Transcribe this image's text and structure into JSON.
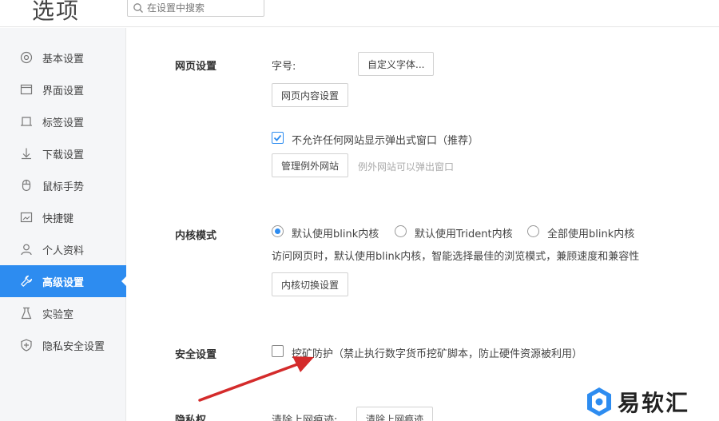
{
  "header": {
    "title": "选项",
    "search_placeholder": "在设置中搜索"
  },
  "sidebar": {
    "items": [
      {
        "label": "基本设置",
        "icon": "settings-circle-icon"
      },
      {
        "label": "界面设置",
        "icon": "window-icon"
      },
      {
        "label": "标签设置",
        "icon": "tab-icon"
      },
      {
        "label": "下载设置",
        "icon": "download-icon"
      },
      {
        "label": "鼠标手势",
        "icon": "mouse-icon"
      },
      {
        "label": "快捷键",
        "icon": "keyboard-icon"
      },
      {
        "label": "个人资料",
        "icon": "user-icon"
      },
      {
        "label": "高级设置",
        "icon": "wrench-icon",
        "active": true
      },
      {
        "label": "实验室",
        "icon": "flask-icon"
      },
      {
        "label": "隐私安全设置",
        "icon": "shield-icon"
      }
    ],
    "accent_color": "#2d8cf0"
  },
  "webpage": {
    "section": "网页设置",
    "font_label": "字号:",
    "custom_font_button": "自定义字体...",
    "content_settings_button": "网页内容设置",
    "popup_checkbox_label": "不允许任何网站显示弹出式窗口（推荐）",
    "popup_checked": true,
    "manage_exceptions_button": "管理例外网站",
    "exceptions_hint": "例外网站可以弹出窗口"
  },
  "kernel": {
    "section": "内核模式",
    "options": [
      "默认使用blink内核",
      "默认使用Trident内核",
      "全部使用blink内核"
    ],
    "selected": "默认使用blink内核",
    "description": "访问网页时，默认使用blink内核，智能选择最佳的浏览模式，兼顾速度和兼容性",
    "switch_button": "内核切换设置"
  },
  "security": {
    "section": "安全设置",
    "mining_label": "挖矿防护（禁止执行数字货币挖矿脚本，防止硬件资源被利用）",
    "mining_checked": false
  },
  "privacy": {
    "section": "隐私权",
    "clear_label": "清除上网痕迹:",
    "clear_button": "清除上网痕迹"
  },
  "watermark": {
    "text": "易软汇"
  }
}
